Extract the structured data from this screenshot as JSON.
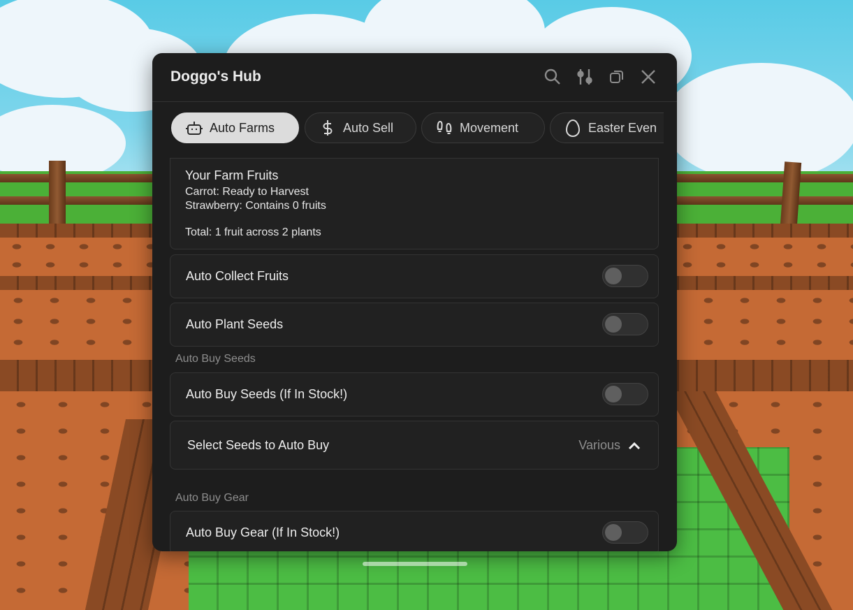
{
  "window": {
    "title": "Doggo's Hub",
    "accent": "#dcdcdc",
    "background": "#1d1d1d"
  },
  "titlebar_icons": [
    "search-icon",
    "sliders-icon",
    "restore-icon",
    "close-icon"
  ],
  "tabs": [
    {
      "label": "Auto Farms",
      "icon": "robot-icon",
      "active": true
    },
    {
      "label": "Auto Sell",
      "icon": "dollar-icon",
      "active": false
    },
    {
      "label": "Movement",
      "icon": "footprints-icon",
      "active": false
    },
    {
      "label": "Easter Even",
      "icon": "egg-icon",
      "active": false
    }
  ],
  "farm_info": {
    "title": "Your Farm Fruits",
    "lines": [
      "Carrot: Ready to Harvest",
      "Strawberry: Contains 0 fruits"
    ],
    "total": "Total: 1 fruit across 2 plants"
  },
  "toggles": {
    "auto_collect": {
      "label": "Auto Collect Fruits",
      "on": false
    },
    "auto_plant": {
      "label": "Auto Plant Seeds",
      "on": false
    },
    "auto_buy_seeds": {
      "label": "Auto Buy Seeds (If In Stock!)",
      "on": false
    },
    "auto_buy_gear": {
      "label": "Auto Buy Gear (If In Stock!)",
      "on": false
    }
  },
  "sections": {
    "seeds": "Auto Buy Seeds",
    "gear": "Auto Buy Gear"
  },
  "seed_dropdown": {
    "label": "Select Seeds to Auto Buy",
    "value": "Various"
  }
}
